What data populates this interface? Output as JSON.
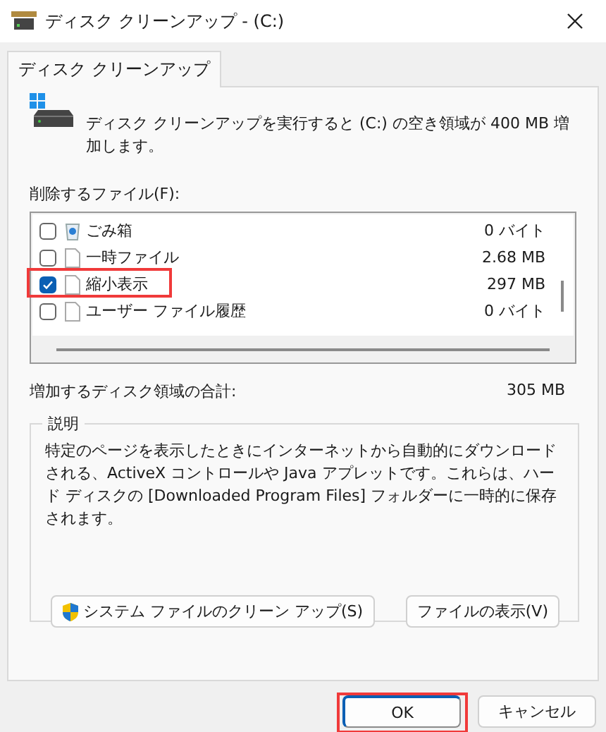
{
  "window": {
    "title": "ディスク クリーンアップ - (C:)"
  },
  "tabs": [
    {
      "label": "ディスク クリーンアップ",
      "selected": true
    }
  ],
  "intro": "ディスク クリーンアップを実行すると (C:) の空き領域が 400 MB 増加します。",
  "files_label": "削除するファイル(F):",
  "files": [
    {
      "kind": "recycle_bin",
      "name": "ごみ箱",
      "size": "0 バイト",
      "checked": false,
      "highlighted": false
    },
    {
      "kind": "file",
      "name": "一時ファイル",
      "size": "2.68 MB",
      "checked": false,
      "highlighted": false
    },
    {
      "kind": "file",
      "name": "縮小表示",
      "size": "297 MB",
      "checked": true,
      "highlighted": true
    },
    {
      "kind": "file",
      "name": "ユーザー ファイル履歴",
      "size": "0 バイト",
      "checked": false,
      "highlighted": false
    }
  ],
  "total_label": "増加するディスク領域の合計:",
  "total_value": "305 MB",
  "description": {
    "title": "説明",
    "text": "特定のページを表示したときにインターネットから自動的にダウンロードされる、ActiveX コントロールや Java アプレットです。これらは、ハード ディスクの [Downloaded Program Files] フォルダーに一時的に保存されます。"
  },
  "actions": [
    {
      "kind": "shield",
      "label": "システム ファイルのクリーン アップ(S)"
    },
    {
      "kind": "plain",
      "label": "ファイルの表示(V)"
    }
  ],
  "dialog_buttons": [
    {
      "label": "OK",
      "default": true,
      "highlighted": true
    },
    {
      "label": "キャンセル",
      "default": false,
      "highlighted": false
    }
  ]
}
